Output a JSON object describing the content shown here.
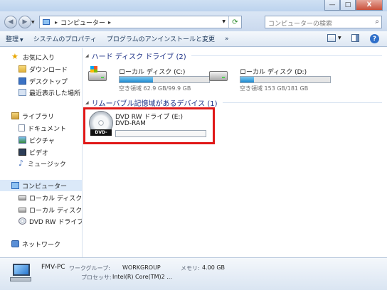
{
  "window": {
    "minimize": "—",
    "maximize": "□",
    "close": "X"
  },
  "address": {
    "back": "◀",
    "forward": "▶",
    "location": "コンピューター",
    "sep1": "▸",
    "sep2": "▸",
    "search_placeholder": "コンピューターの検索"
  },
  "toolbar": {
    "organize": "整理",
    "system_properties": "システムのプロパティ",
    "uninstall": "プログラムのアンインストールと変更",
    "more": "»"
  },
  "nav": {
    "favorites": "お気に入り",
    "downloads": "ダウンロード",
    "desktop": "デスクトップ",
    "recent": "最近表示した場所",
    "libraries": "ライブラリ",
    "documents": "ドキュメント",
    "pictures": "ピクチャ",
    "videos": "ビデオ",
    "music": "ミュージック",
    "computer": "コンピューター",
    "local_c": "ローカル ディスク (",
    "local_d": "ローカル ディスク (",
    "dvd": "DVD RW ドライブ",
    "network": "ネットワーク"
  },
  "content": {
    "hdd_group": "ハード ディスク ドライブ (2)",
    "removable_group": "リムーバブル記憶域があるデバイス (1)",
    "drive_c": {
      "name": "ローカル ディスク (C:)",
      "free": "空き領域 62.9 GB/99.9 GB",
      "used_fraction": 0.37
    },
    "drive_d": {
      "name": "ローカル ディスク (D:)",
      "free": "空き領域 153 GB/181 GB",
      "used_fraction": 0.15
    },
    "dvd": {
      "name": "DVD RW ドライブ (E:)",
      "fs": "DVD-RAM",
      "label": "DVD-RAM"
    }
  },
  "details": {
    "pc_name": "FMV-PC",
    "workgroup_label": "ワークグループ:",
    "workgroup": "WORKGROUP",
    "memory_label": "メモリ:",
    "memory": "4.00 GB",
    "processor_label": "プロセッサ:",
    "processor": "Intel(R) Core(TM)2 ..."
  },
  "colors": {
    "accent": "#1e3287",
    "highlight": "#e01818",
    "bar_fill": "#1e8bd1"
  }
}
